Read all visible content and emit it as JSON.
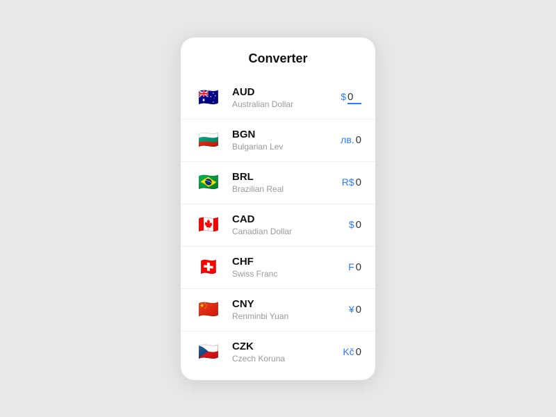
{
  "card": {
    "title": "Converter"
  },
  "currencies": [
    {
      "code": "AUD",
      "name": "Australian Dollar",
      "symbol": "$",
      "value": "0",
      "flag": "🇦🇺",
      "isBase": true
    },
    {
      "code": "BGN",
      "name": "Bulgarian Lev",
      "symbol": "лв.",
      "value": "0",
      "flag": "🇧🇬",
      "isBase": false
    },
    {
      "code": "BRL",
      "name": "Brazilian Real",
      "symbol": "R$",
      "value": "0",
      "flag": "🇧🇷",
      "isBase": false
    },
    {
      "code": "CAD",
      "name": "Canadian Dollar",
      "symbol": "$",
      "value": "0",
      "flag": "🇨🇦",
      "isBase": false
    },
    {
      "code": "CHF",
      "name": "Swiss Franc",
      "symbol": "F",
      "value": "0",
      "flag": "🇨🇭",
      "isBase": false
    },
    {
      "code": "CNY",
      "name": "Renminbi Yuan",
      "symbol": "¥",
      "value": "0",
      "flag": "🇨🇳",
      "isBase": false
    },
    {
      "code": "CZK",
      "name": "Czech Koruna",
      "symbol": "Kč",
      "value": "0",
      "flag": "🇨🇿",
      "isBase": false
    }
  ]
}
